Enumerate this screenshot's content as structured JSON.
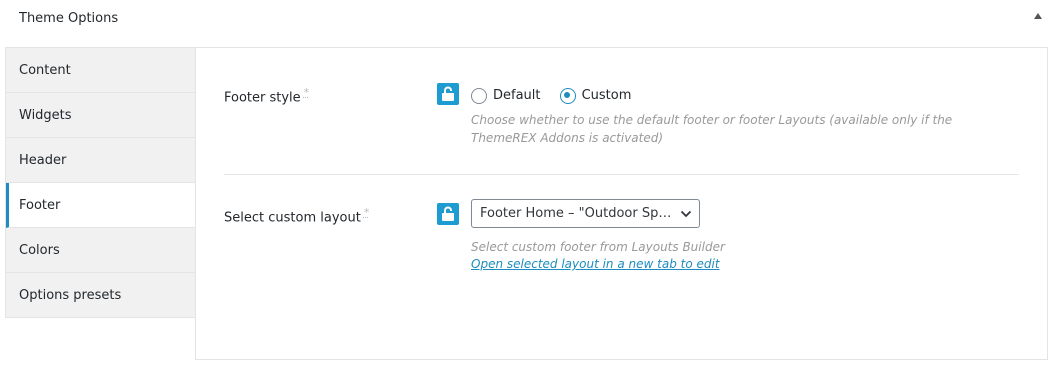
{
  "panel": {
    "title": "Theme Options"
  },
  "tabs": [
    {
      "label": "Content",
      "active": false
    },
    {
      "label": "Widgets",
      "active": false
    },
    {
      "label": "Header",
      "active": false
    },
    {
      "label": "Footer",
      "active": true
    },
    {
      "label": "Colors",
      "active": false
    },
    {
      "label": "Options presets",
      "active": false
    }
  ],
  "footer_style": {
    "label": "Footer style",
    "required_mark": "*",
    "options": [
      "Default",
      "Custom"
    ],
    "selected": "Custom",
    "description": "Choose whether to use the default footer or footer Layouts (available only if the ThemeREX Addons is activated)"
  },
  "custom_layout": {
    "label": "Select custom layout",
    "required_mark": "*",
    "selected_value": "Footer Home – \"Outdoor Spo...",
    "description": "Select custom footer from Layouts Builder",
    "link_text": "Open selected layout in a new tab to edit"
  },
  "colors": {
    "accent": "#1e8cbe",
    "lock_button": "#1e9bd0",
    "tab_bg": "#f1f1f1"
  }
}
